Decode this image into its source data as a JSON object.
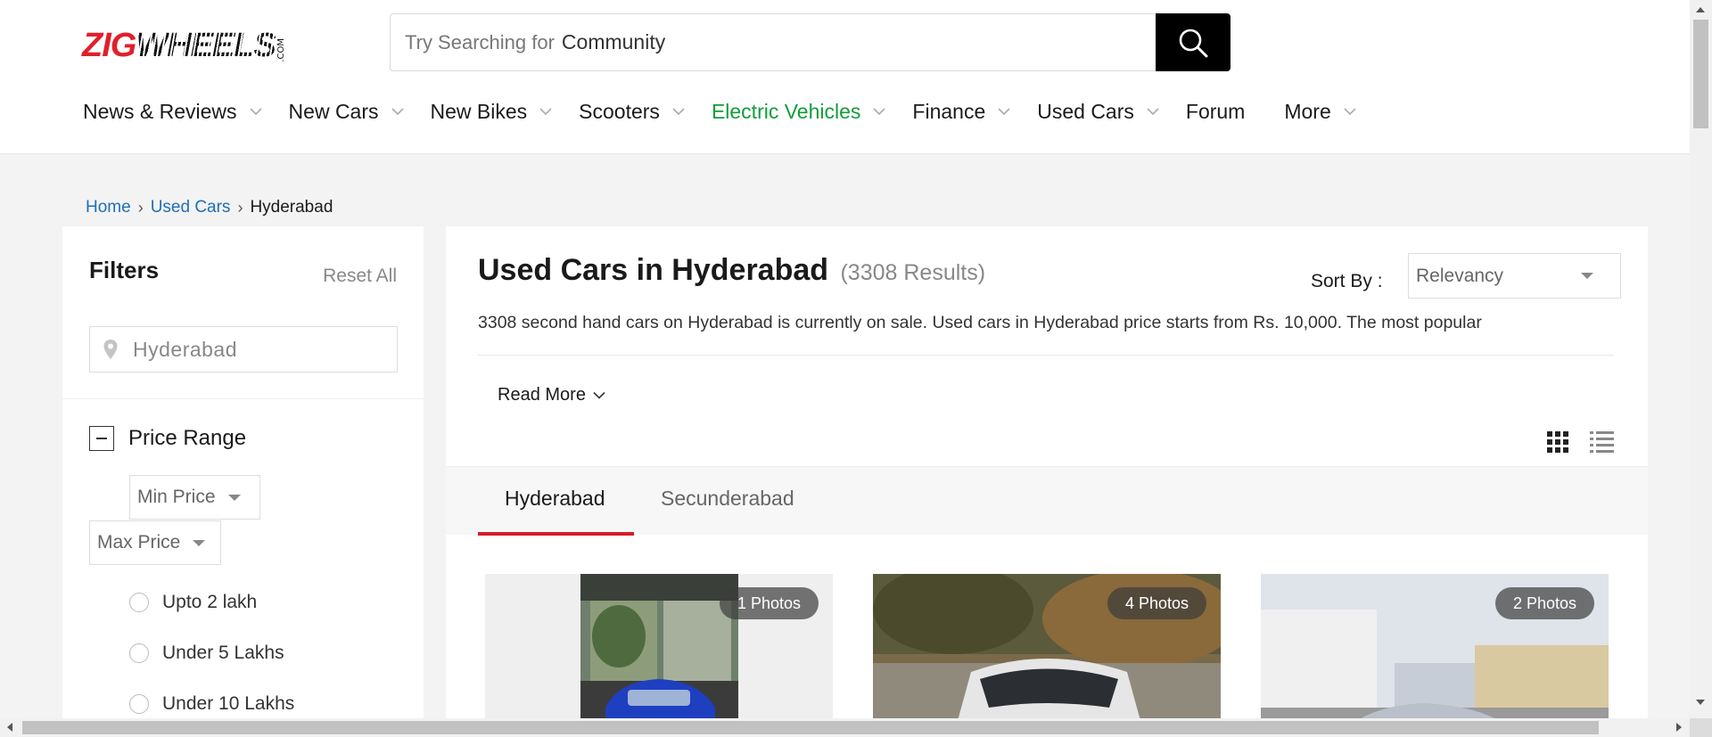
{
  "header": {
    "logo": {
      "brand_red": "ZIG",
      "brand_dark": "WHEELS",
      "suffix": ".COM"
    },
    "search": {
      "prefix": "Try Searching for",
      "term": "Community"
    },
    "nav": [
      {
        "label": "News & Reviews",
        "has_dropdown": true
      },
      {
        "label": "New Cars",
        "has_dropdown": true
      },
      {
        "label": "New Bikes",
        "has_dropdown": true
      },
      {
        "label": "Scooters",
        "has_dropdown": true
      },
      {
        "label": "Electric Vehicles",
        "has_dropdown": true
      },
      {
        "label": "Finance",
        "has_dropdown": true
      },
      {
        "label": "Used Cars",
        "has_dropdown": true
      },
      {
        "label": "Forum",
        "has_dropdown": false
      },
      {
        "label": "More",
        "has_dropdown": true
      }
    ]
  },
  "breadcrumb": {
    "home": "Home",
    "used_cars": "Used Cars",
    "current": "Hyderabad",
    "separator": "›"
  },
  "filters": {
    "title": "Filters",
    "reset": "Reset All",
    "location": "Hyderabad",
    "price_range": {
      "label": "Price Range",
      "min_placeholder": "Min Price",
      "max_placeholder": "Max Price",
      "options": [
        "Upto 2 lakh",
        "Under 5 Lakhs",
        "Under 10 Lakhs"
      ]
    }
  },
  "main": {
    "heading": "Used Cars in Hyderabad",
    "result_count": "(3308 Results)",
    "sort_label": "Sort By :",
    "sort_value": "Relevancy",
    "description": "3308 second hand cars on Hyderabad is currently on sale. Used cars in Hyderabad price starts from Rs. 10,000. The most popular",
    "read_more": "Read More",
    "tabs": [
      "Hyderabad",
      "Secunderabad"
    ],
    "active_tab": "Hyderabad",
    "cards": [
      {
        "photos": "1 Photos"
      },
      {
        "photos": "4 Photos"
      },
      {
        "photos": "2 Photos"
      }
    ]
  },
  "colors": {
    "brand_red": "#e0202b",
    "ev_green": "#119d3a",
    "link_blue": "#1f6fb5",
    "tab_active": "#d41d2b"
  }
}
